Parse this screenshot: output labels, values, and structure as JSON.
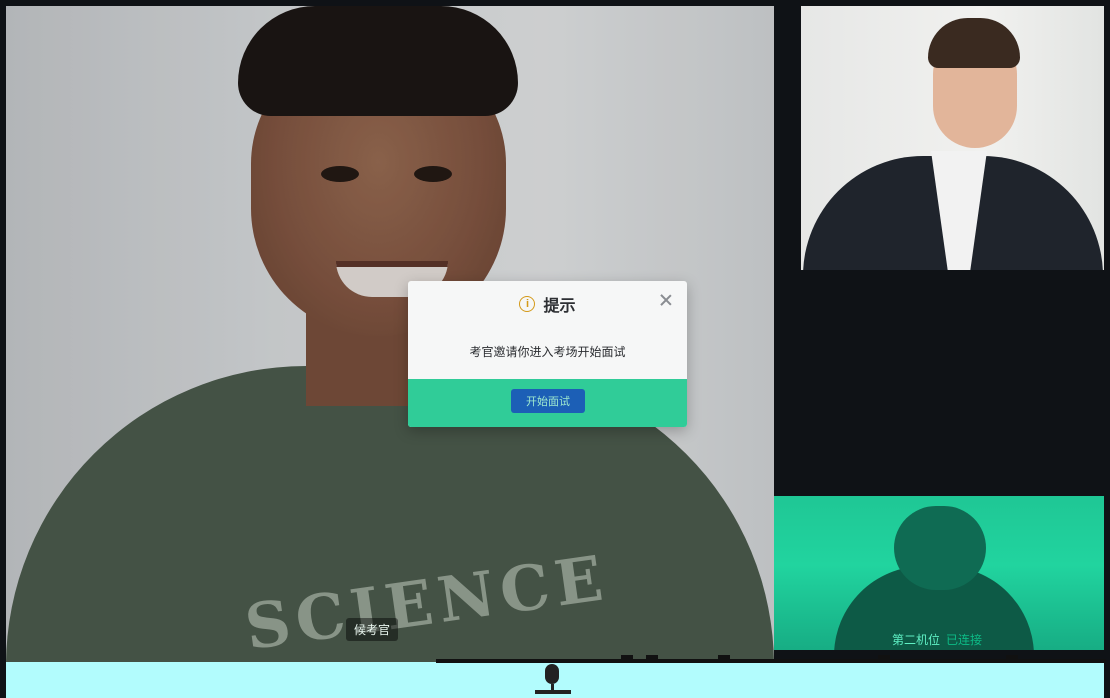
{
  "main_video": {
    "label": "候考官",
    "shirt_text": "SCIENCE"
  },
  "side_videos": {
    "bottom_label": "第二机位",
    "bottom_status": "已连接"
  },
  "modal": {
    "title": "提示",
    "message": "考官邀请你进入考场开始面试",
    "confirm_label": "开始面试",
    "info_glyph": "i",
    "icons": [
      "info-icon",
      "close-icon",
      "microphone-icon"
    ]
  },
  "colors": {
    "accent_green": "#25c992",
    "button_blue": "#1c5fb6",
    "warning_orange": "#d49a1a",
    "control_bar": "#b2fcfd"
  }
}
